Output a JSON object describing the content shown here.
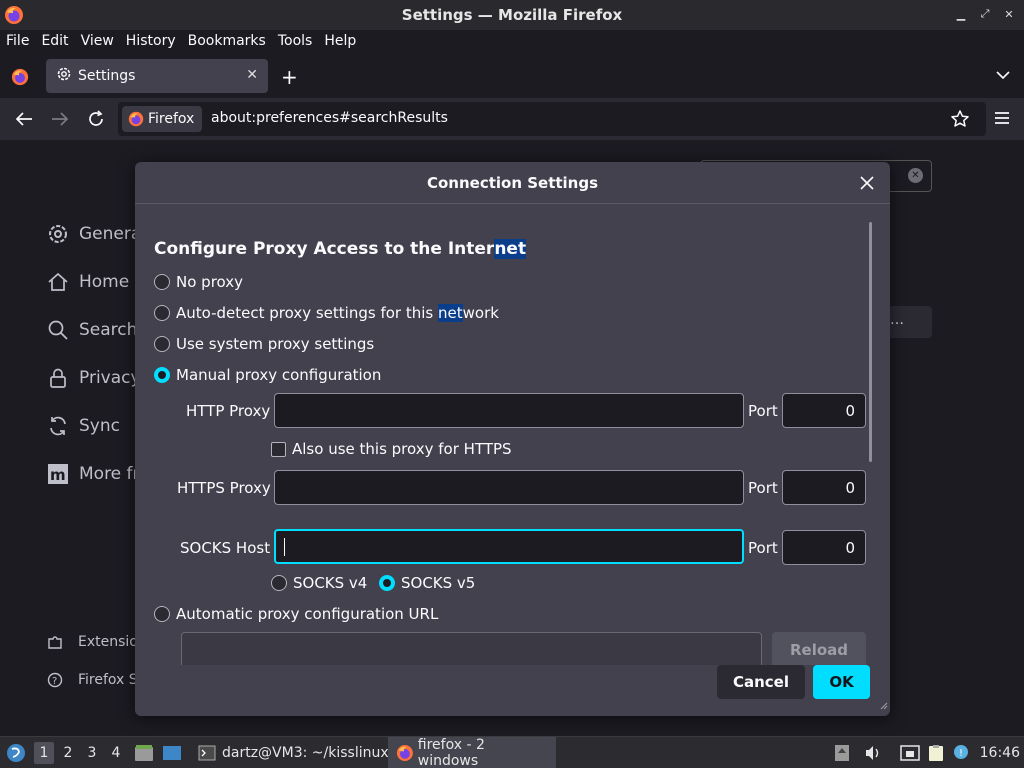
{
  "window": {
    "title": "Settings — Mozilla Firefox"
  },
  "menu": [
    "File",
    "Edit",
    "View",
    "History",
    "Bookmarks",
    "Tools",
    "Help"
  ],
  "tab": {
    "label": "Settings"
  },
  "urlbar": {
    "identity": "Firefox",
    "url": "about:preferences#searchResults"
  },
  "sidebar": {
    "items": [
      "Genera",
      "Home",
      "Search",
      "Privacy",
      "Sync",
      "More fr"
    ],
    "bottom": [
      "Extensio",
      "Firefox S"
    ]
  },
  "dialog": {
    "title": "Connection Settings",
    "heading_prefix": "Configure Proxy Access to the Inter",
    "heading_highlight": "net",
    "options": {
      "no_proxy": "No proxy",
      "auto_detect_prefix": "Auto-detect proxy settings for this ",
      "auto_detect_highlight": "net",
      "auto_detect_suffix": "work",
      "system": "Use system proxy settings",
      "manual": "Manual proxy configuration",
      "auto_url": "Automatic proxy configuration URL"
    },
    "selected_option": "manual",
    "http_proxy": {
      "label": "HTTP Proxy",
      "value": "",
      "port_label": "Port",
      "port": "0"
    },
    "also_https": {
      "label": "Also use this proxy for HTTPS",
      "checked": false
    },
    "https_proxy": {
      "label": "HTTPS Proxy",
      "value": "",
      "port_label": "Port",
      "port": "0"
    },
    "socks_host": {
      "label": "SOCKS Host",
      "value": "",
      "port_label": "Port",
      "port": "0"
    },
    "socks_version": {
      "v4": "SOCKS v4",
      "v5": "SOCKS v5",
      "selected": "v5"
    },
    "pac_url": {
      "value": "",
      "reload": "Reload"
    },
    "cancel": "Cancel",
    "ok": "OK"
  },
  "taskbar": {
    "workspaces": [
      "1",
      "2",
      "3",
      "4"
    ],
    "active_workspace": "1",
    "windows": [
      "dartz@VM3: ~/kisslinux",
      "firefox - 2 windows"
    ],
    "clock": "16:46"
  },
  "colors": {
    "accent": "#00ddff",
    "dialog_bg": "#42414d",
    "page_bg": "#1c1b22",
    "highlight": "#0a3e8a"
  }
}
